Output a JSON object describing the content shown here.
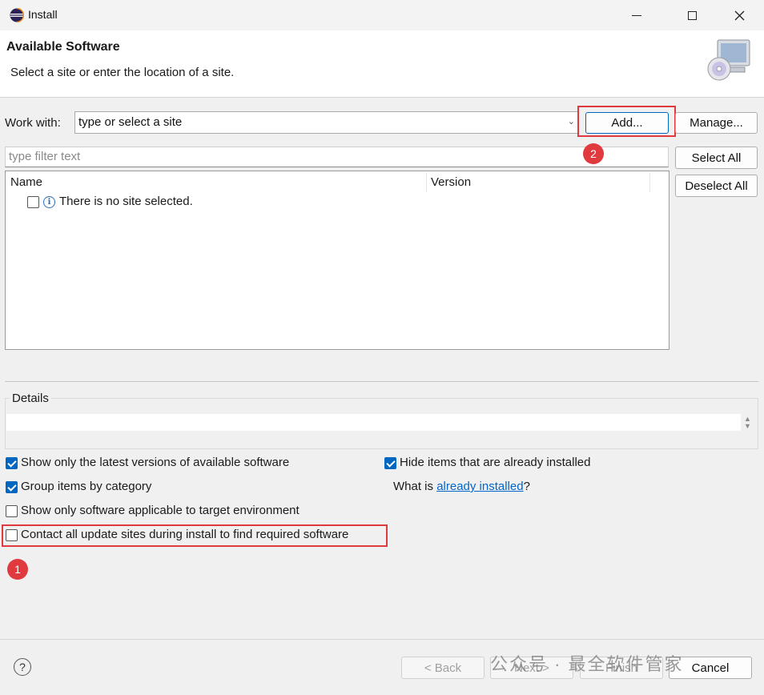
{
  "window": {
    "title": "Install"
  },
  "header": {
    "title": "Available Software",
    "subtitle": "Select a site or enter the location of a site."
  },
  "work_with": {
    "label": "Work with:",
    "value": "type or select a site",
    "add_label": "Add...",
    "manage_label": "Manage..."
  },
  "filter": {
    "placeholder": "type filter text"
  },
  "side_buttons": {
    "select_all": "Select All",
    "deselect_all": "Deselect All"
  },
  "table": {
    "columns": [
      "Name",
      "Version"
    ],
    "rows": [
      {
        "label": "There is no site selected.",
        "checked": false
      }
    ]
  },
  "details": {
    "label": "Details"
  },
  "options": {
    "latest_versions": {
      "label": "Show only the latest versions of available software",
      "checked": true
    },
    "group_by_category": {
      "label": "Group items by category",
      "checked": true
    },
    "target_env": {
      "label": "Show only software applicable to target environment",
      "checked": false
    },
    "contact_sites": {
      "label": "Contact all update sites during install to find required software",
      "checked": false
    },
    "hide_installed": {
      "label": "Hide items that are already installed",
      "checked": true
    },
    "what_is": {
      "prefix": "What is ",
      "link": "already installed",
      "suffix": "?"
    }
  },
  "annotations": {
    "badge1": "1",
    "badge2": "2",
    "highlight_color": "#e0393e"
  },
  "footer": {
    "help": "?",
    "back": "< Back",
    "next": "Next >",
    "finish": "Finish",
    "cancel": "Cancel"
  },
  "watermark": "公众号 · 最全软件管家"
}
